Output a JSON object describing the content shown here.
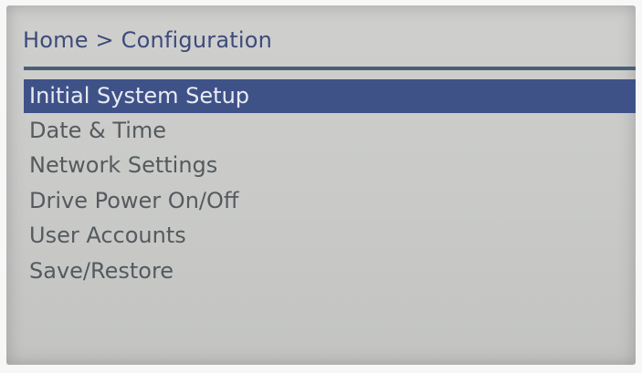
{
  "header": {
    "breadcrumb": "Home > Configuration"
  },
  "menu": {
    "selected_index": 0,
    "items": [
      {
        "label": "Initial System Setup"
      },
      {
        "label": "Date & Time"
      },
      {
        "label": "Network Settings"
      },
      {
        "label": "Drive Power On/Off"
      },
      {
        "label": "User Accounts"
      },
      {
        "label": "Save/Restore"
      }
    ]
  },
  "colors": {
    "highlight": "#3f5288",
    "text": "#555a5e",
    "breadcrumb": "#3e4a7a",
    "divider": "#4a5f76"
  }
}
